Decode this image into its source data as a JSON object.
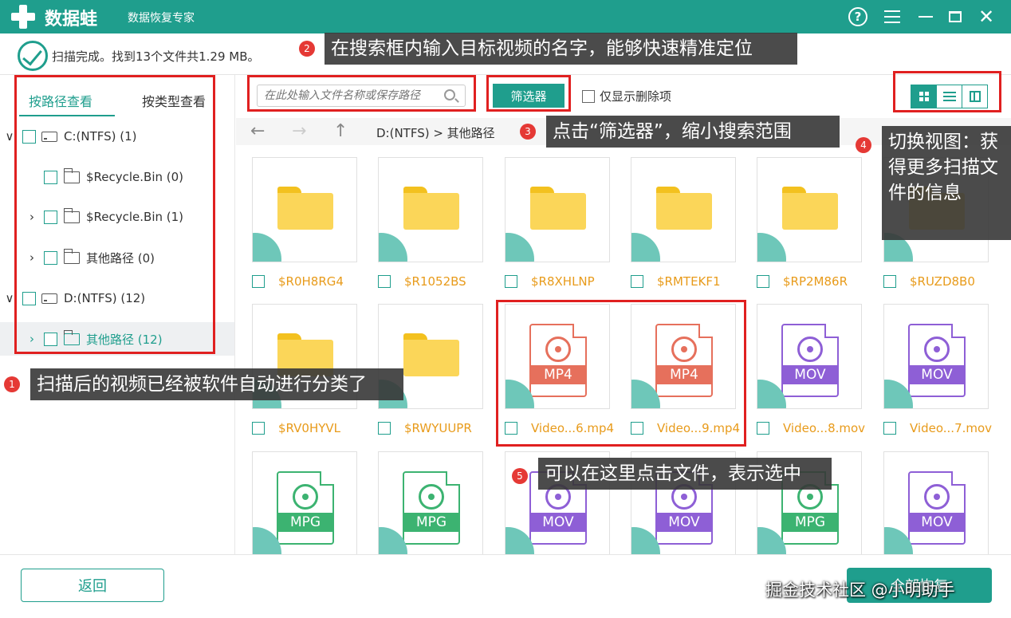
{
  "app": {
    "name": "数据蛙",
    "subtitle": "数据恢复专家",
    "help_glyph": "?",
    "close_glyph": "✕"
  },
  "status": {
    "text": "扫描完成。找到13个文件共1.29 MB。"
  },
  "sidebar": {
    "tabs": [
      {
        "label": "按路径查看"
      },
      {
        "label": "按类型查看"
      }
    ],
    "tree": [
      {
        "label": "C:(NTFS) (1)",
        "chevron": "∨"
      },
      {
        "label": "$Recycle.Bin (0)",
        "chevron": ""
      },
      {
        "label": "$Recycle.Bin (1)",
        "chevron": "›"
      },
      {
        "label": "其他路径 (0)",
        "chevron": "›"
      },
      {
        "label": "D:(NTFS) (12)",
        "chevron": "∨"
      },
      {
        "label": "其他路径 (12)",
        "chevron": "›"
      }
    ]
  },
  "toolbar": {
    "search_placeholder": "在此处输入文件名称或保存路径",
    "filter_label": "筛选器",
    "deleted_only_label": "仅显示删除项"
  },
  "nav": {
    "back": "←",
    "forward": "→",
    "up": "↑",
    "breadcrumb": "D:(NTFS) > 其他路径"
  },
  "files": {
    "row1": [
      {
        "name": "$R0H8RG4",
        "kind": "folder"
      },
      {
        "name": "$R1052BS",
        "kind": "folder"
      },
      {
        "name": "$R8XHLNP",
        "kind": "folder"
      },
      {
        "name": "$RMTEKF1",
        "kind": "folder"
      },
      {
        "name": "$RP2M86R",
        "kind": "folder"
      },
      {
        "name": "$RUZD8B0",
        "kind": "folder"
      }
    ],
    "row2": [
      {
        "name": "$RV0HYVL",
        "kind": "folder"
      },
      {
        "name": "$RWYUUPR",
        "kind": "folder"
      },
      {
        "name": "Video...6.mp4",
        "kind": "MP4"
      },
      {
        "name": "Video...9.mp4",
        "kind": "MP4"
      },
      {
        "name": "Video...8.mov",
        "kind": "MOV"
      },
      {
        "name": "Video...7.mov",
        "kind": "MOV"
      }
    ],
    "row3": [
      {
        "kind": "MPG"
      },
      {
        "kind": "MPG"
      },
      {
        "kind": "MOV"
      },
      {
        "kind": "MOV"
      },
      {
        "kind": "MPG"
      },
      {
        "kind": "MOV"
      }
    ]
  },
  "footer": {
    "back_label": "返回",
    "recover_label": "全部恢复"
  },
  "annotations": [
    {
      "num": "1",
      "text": "扫描后的视频已经被软件自动进行分类了"
    },
    {
      "num": "2",
      "text": "在搜索框内输入目标视频的名字，能够快速精准定位"
    },
    {
      "num": "3",
      "text": "点击“筛选器”，缩小搜索范围"
    },
    {
      "num": "4",
      "text": "切换视图：获得更多扫描文件的信息"
    },
    {
      "num": "5",
      "text": "可以在这里点击文件，表示选中"
    }
  ],
  "watermark": "掘金技术社区 @小明助手",
  "colors": {
    "accent": "#1f9e8d",
    "highlight": "#e02020",
    "mp4": "#e6705c",
    "mov": "#8e5fd6",
    "mpg": "#3cb371",
    "folder": "#fbd659"
  }
}
